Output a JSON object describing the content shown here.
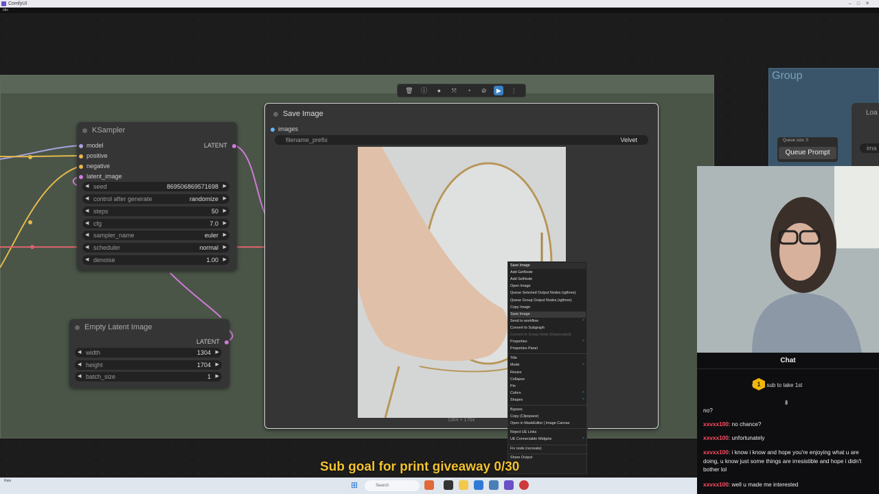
{
  "window": {
    "title": "ComfyUI",
    "menu": "Idle"
  },
  "groups": {
    "right_title": "Group"
  },
  "toolbar": {
    "buttons": [
      "trash-icon",
      "info-icon",
      "color-icon",
      "bypass-icon",
      "mask-icon",
      "mute-icon",
      "run-icon",
      "more-icon"
    ]
  },
  "ksampler": {
    "title": "KSampler",
    "inputs": [
      "model",
      "positive",
      "negative",
      "latent_image"
    ],
    "output": "LATENT",
    "widgets": [
      {
        "label": "seed",
        "value": "869506869571698"
      },
      {
        "label": "control after generate",
        "value": "randomize"
      },
      {
        "label": "steps",
        "value": "50"
      },
      {
        "label": "cfg",
        "value": "7.0"
      },
      {
        "label": "sampler_name",
        "value": "euler"
      },
      {
        "label": "scheduler",
        "value": "normal"
      },
      {
        "label": "denoise",
        "value": "1.00"
      }
    ]
  },
  "empty_latent": {
    "title": "Empty Latent Image",
    "output": "LATENT",
    "widgets": [
      {
        "label": "width",
        "value": "1304"
      },
      {
        "label": "height",
        "value": "1704"
      },
      {
        "label": "batch_size",
        "value": "1"
      }
    ]
  },
  "save_image": {
    "title": "Save Image",
    "input": "images",
    "filename_label": "filename_prefix",
    "filename_value": "Velvet",
    "image_size": "1304 × 1704"
  },
  "context_menu": {
    "items": [
      {
        "label": "Save Image",
        "type": "header"
      },
      {
        "label": "Add GetNode"
      },
      {
        "label": "Add SetNode"
      },
      {
        "label": "Open Image"
      },
      {
        "label": "Queue Selected Output Nodes (rgthree)"
      },
      {
        "label": "Queue Group Output Nodes (rgthree)"
      },
      {
        "label": "Copy Image"
      },
      {
        "label": "Save Image",
        "type": "hover"
      },
      {
        "label": "Send to workflow",
        "submenu": true
      },
      {
        "label": "Convert to Subgraph"
      },
      {
        "label": "Convert to Group Node (Deprecated)",
        "type": "disabled"
      },
      {
        "label": "Properties",
        "submenu": true
      },
      {
        "label": "Properties Panel"
      },
      {
        "label": "Title"
      },
      {
        "label": "Mode",
        "submenu": true
      },
      {
        "label": "Resize"
      },
      {
        "label": "Collapse"
      },
      {
        "label": "Pin"
      },
      {
        "label": "Colors",
        "submenu": true
      },
      {
        "label": "Shapes",
        "submenu": true
      },
      {
        "label": "Bypass"
      },
      {
        "label": "Copy (Clipspace)"
      },
      {
        "label": "Open in MaskEditor | Image Canvas"
      },
      {
        "label": "Reject UE Links"
      },
      {
        "label": "UE Connectable Widgets",
        "submenu": true
      },
      {
        "label": "Fix node (recreate)"
      },
      {
        "label": "Share Output"
      }
    ]
  },
  "queue": {
    "size_label": "Queue size: 0",
    "button": "Queue Prompt"
  },
  "right_node": {
    "title": "Loa",
    "widget": "ima"
  },
  "chat": {
    "title": "Chat",
    "gift_badge": "1",
    "gift_text": "Gift 1 sub to take 1st",
    "messages": [
      {
        "user": "",
        "text": "no?"
      },
      {
        "user": "xxvxx100",
        "text": "no chance?"
      },
      {
        "user": "xxvxx100",
        "text": "unfortunately"
      },
      {
        "user": "xxvxx100",
        "text": "i know i know and hope you're enjoying what u are doing, u know just some things are irresistible and hope i didn't bother lol"
      },
      {
        "user": "xxvxx100",
        "text": "well u made me interested"
      }
    ]
  },
  "overlay": {
    "sub_goal": "Sub goal for print giveaway 0/30"
  },
  "taskbar": {
    "search": "Search",
    "weather": "Rain"
  }
}
